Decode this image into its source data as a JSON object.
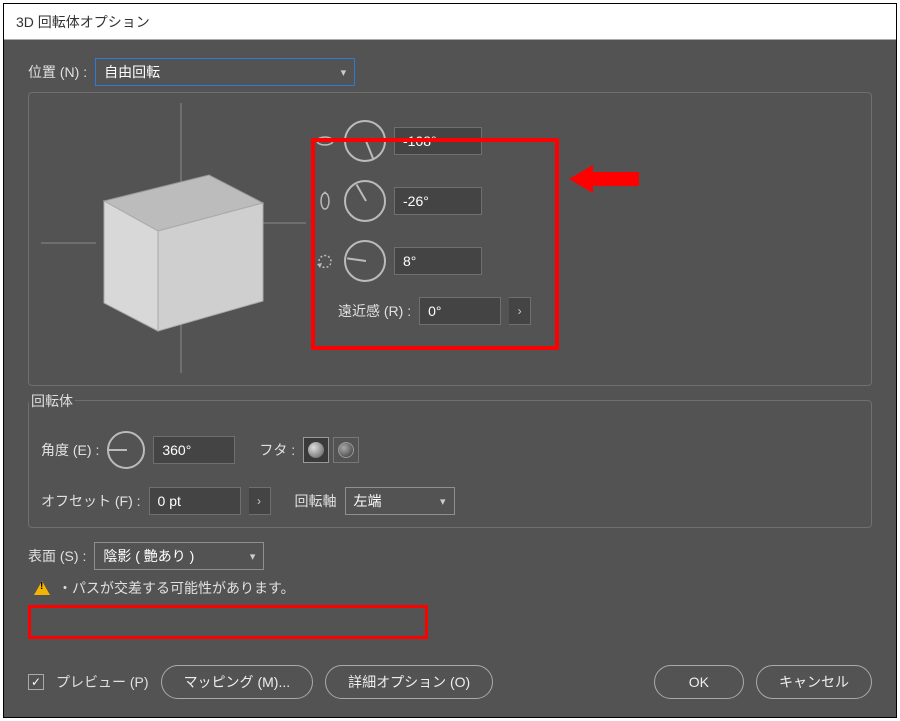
{
  "window": {
    "title": "3D 回転体オプション"
  },
  "position": {
    "label": "位置 (N) :",
    "value": "自由回転"
  },
  "rotation": {
    "x": {
      "value": "-108°",
      "angle": 338
    },
    "y": {
      "value": "-26°",
      "angle": 150
    },
    "z": {
      "value": "8°",
      "angle": 98
    }
  },
  "perspective": {
    "label": "遠近感 (R) :",
    "value": "0°"
  },
  "revolve": {
    "group_label": "回転体",
    "angle_label": "角度 (E) :",
    "angle_value": "360°",
    "cap_label": "フタ :",
    "offset_label": "オフセット (F) :",
    "offset_value": "0 pt",
    "axis_label": "回転軸",
    "axis_value": "左端"
  },
  "surface": {
    "label": "表面 (S) :",
    "value": "陰影 ( 艶あり )"
  },
  "warning": {
    "text": "・パスが交差する可能性があります。"
  },
  "footer": {
    "preview_label": "プレビュー (P)",
    "preview_checked": true,
    "map_label": "マッピング (M)...",
    "more_label": "詳細オプション (O)",
    "ok_label": "OK",
    "cancel_label": "キャンセル"
  }
}
